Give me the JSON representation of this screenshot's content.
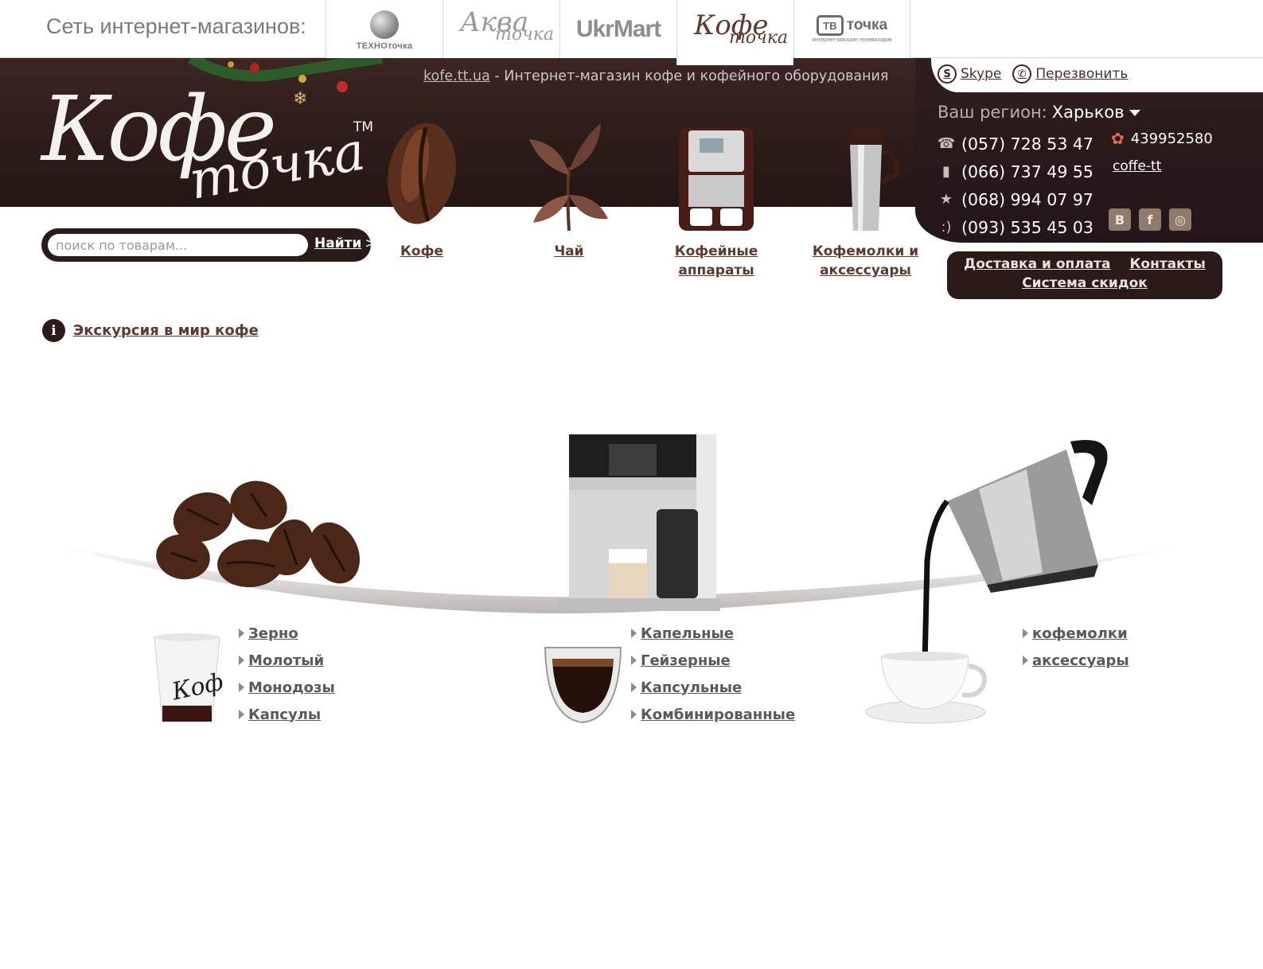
{
  "network": {
    "label": "Сеть интернет-магазинов:",
    "shops": [
      {
        "name": "ТЕХНОточка"
      },
      {
        "line1": "Аква",
        "line2": "точка"
      },
      {
        "name": "UkrMart"
      },
      {
        "line1": "Кофе",
        "line2": "точка"
      },
      {
        "badge": "ТВ",
        "word": "точка",
        "sub": "интернет-магазин телевизоров"
      }
    ]
  },
  "header": {
    "site_link": "kofe.tt.ua",
    "tagline": " - Интернет-магазин кофе и кофейного оборудования",
    "logo": {
      "word1": "Кофе",
      "word2": "точка",
      "tm": "TM"
    },
    "skype": "Skype",
    "callback": "Перезвонить",
    "region_label": "Ваш регион:",
    "region_city": "Харьков",
    "phones": [
      "(057) 728 53 47",
      "(066) 737 49 55",
      "(068) 994 07 97",
      "(093) 535 45 03"
    ],
    "icq": "439952580",
    "skype_login": "coffe-tt",
    "socials": [
      "В",
      "f",
      "◎"
    ]
  },
  "search": {
    "placeholder": "поиск по товарам...",
    "button": "Найти",
    "arrows": ">>>"
  },
  "categories": [
    {
      "label": "Кофе"
    },
    {
      "label": "Чай"
    },
    {
      "line1": "Кофейные",
      "line2": "аппараты"
    },
    {
      "line1": "Кофемолки и",
      "line2": "аксессуары"
    }
  ],
  "quick_links": [
    "Доставка и оплата",
    "Контакты",
    "Система скидок"
  ],
  "tour": "Экскурсия в мир кофе",
  "showcase": {
    "coffee": [
      "Зерно",
      "Молотый",
      "Монодозы",
      "Капсулы"
    ],
    "machines": [
      "Капельные",
      "Гейзерные",
      "Капсульные",
      "Комбинированные"
    ],
    "grinders": [
      "кофемолки",
      "аксессуары"
    ],
    "cup_text": "Коф"
  }
}
